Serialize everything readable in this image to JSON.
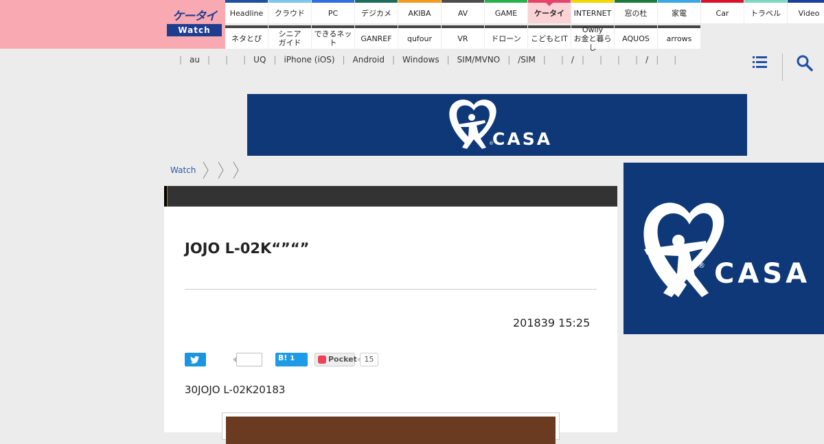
{
  "site": {
    "logo_top": "ケータイ",
    "logo_bottom": "Watch"
  },
  "nav": {
    "row1": [
      {
        "label": "Headline",
        "color": "#1e4fa3"
      },
      {
        "label": "クラウド",
        "color": "#7ec6e8"
      },
      {
        "label": "PC",
        "color": "#2f6de0"
      },
      {
        "label": "デジカメ",
        "color": "#1f6b5c"
      },
      {
        "label": "AKIBA",
        "color": "#f29b22"
      },
      {
        "label": "AV",
        "color": "#4d4d4d"
      },
      {
        "label": "GAME",
        "color": "#27b14a"
      },
      {
        "label": "ケータイ",
        "color": "#e8416a",
        "active": true
      },
      {
        "label": "INTERNET",
        "color": "#f1d500"
      },
      {
        "label": "窓の杜",
        "color": "#1e7a3c"
      },
      {
        "label": "家電",
        "color": "#3aa7e2"
      },
      {
        "label": "Car",
        "color": "#d9112b"
      },
      {
        "label": "トラベル",
        "color": "#7fd7c0"
      },
      {
        "label": "Video",
        "color": "#1a3f9c"
      }
    ],
    "row2": [
      {
        "label": "ネタとぴ",
        "color": "#444"
      },
      {
        "label": "シニア\nガイド",
        "color": "#444"
      },
      {
        "label": "できるネット",
        "color": "#444"
      },
      {
        "label": "GANREF",
        "color": "#444"
      },
      {
        "label": "qufour",
        "color": "#444"
      },
      {
        "label": "VR",
        "color": "#444"
      },
      {
        "label": "ドローン",
        "color": "#444"
      },
      {
        "label": "こどもとIT",
        "color": "#444"
      },
      {
        "label": "Owlly\nお金と暮らし",
        "color": "#444"
      },
      {
        "label": "AQUOS",
        "color": "#444"
      },
      {
        "label": "arrows",
        "color": "#444"
      }
    ]
  },
  "subnav": {
    "items": [
      "",
      "au",
      "",
      "",
      "UQ",
      "iPhone (iOS)",
      "Android",
      "Windows",
      "SIM/MVNO",
      "/SIM",
      "",
      "/",
      "",
      "",
      "",
      "/",
      "",
      ""
    ]
  },
  "ads": {
    "top_brand": "CASA",
    "side_brand": "CASA"
  },
  "breadcrumb": {
    "items": [
      "Watch",
      "",
      "",
      ""
    ]
  },
  "article": {
    "title": "JOJO L-02K“”“”",
    "date": "201839 15:25",
    "lead": "30JOJO L-02K20183"
  },
  "share": {
    "hatena_label": "B!",
    "hatena_count": "1",
    "pocket_label": "Pocket",
    "pocket_count": "15"
  },
  "icons": {
    "menu": "hamburger-menu-icon",
    "search": "search-icon",
    "twitter": "twitter-bird-icon",
    "pocket": "pocket-icon"
  }
}
